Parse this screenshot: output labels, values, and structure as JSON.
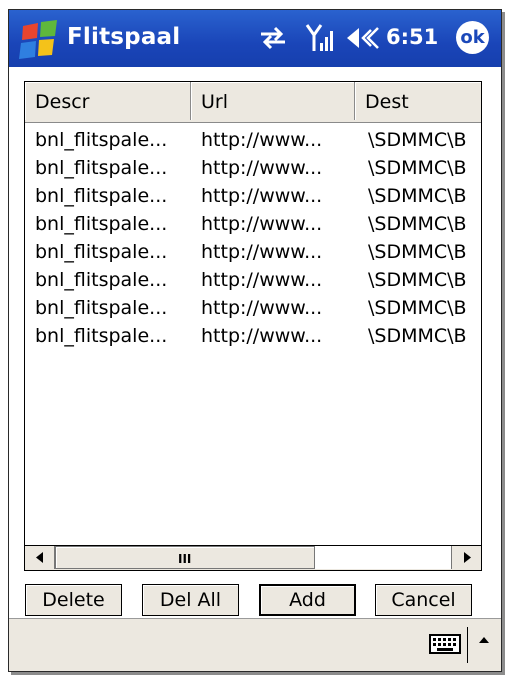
{
  "window": {
    "title": "Flitspaal",
    "clock": "6:51",
    "ok_label": "ok",
    "icons": [
      "windows-start-icon",
      "connectivity-icon",
      "signal-icon",
      "volume-icon"
    ]
  },
  "list": {
    "columns": [
      "Descr",
      "Url",
      "Dest"
    ],
    "rows": [
      [
        "bnl_flitspale...",
        "http://www...",
        "\\SDMMC\\B"
      ],
      [
        "bnl_flitspale...",
        "http://www...",
        "\\SDMMC\\B"
      ],
      [
        "bnl_flitspale...",
        "http://www...",
        "\\SDMMC\\B"
      ],
      [
        "bnl_flitspale...",
        "http://www...",
        "\\SDMMC\\B"
      ],
      [
        "bnl_flitspale...",
        "http://www...",
        "\\SDMMC\\B"
      ],
      [
        "bnl_flitspale...",
        "http://www...",
        "\\SDMMC\\B"
      ],
      [
        "bnl_flitspale...",
        "http://www...",
        "\\SDMMC\\B"
      ],
      [
        "bnl_flitspale...",
        "http://www...",
        "\\SDMMC\\B"
      ]
    ],
    "scrollbar_grip": "III"
  },
  "buttons": {
    "delete": "Delete",
    "del_all": "Del All",
    "add": "Add",
    "cancel": "Cancel"
  },
  "colors": {
    "titlebar": "#1a45b8",
    "chrome": "#ece8e0"
  }
}
